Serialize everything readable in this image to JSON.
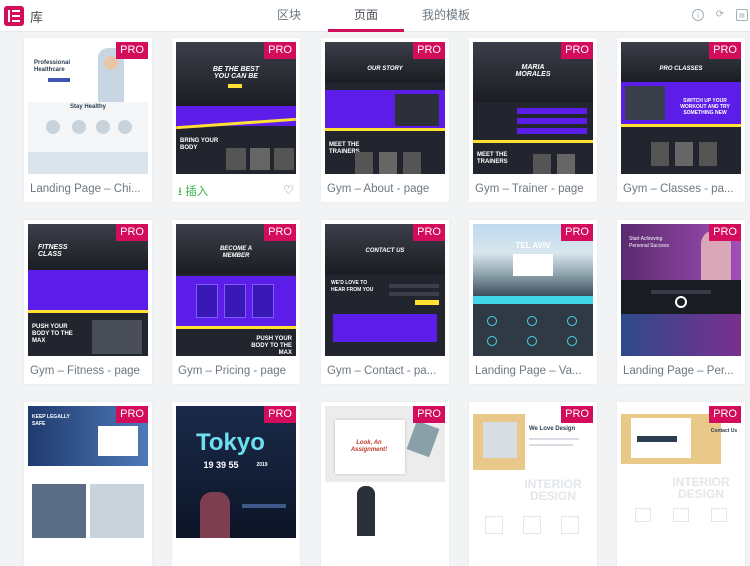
{
  "header": {
    "title": "库",
    "tabs": [
      {
        "label": "区块",
        "active": false
      },
      {
        "label": "页面",
        "active": true
      },
      {
        "label": "我的模板",
        "active": false
      }
    ],
    "icons": [
      "info-icon",
      "sync-icon",
      "save-icon"
    ]
  },
  "colors": {
    "accent": "#d30c5c",
    "insert": "#39b54a",
    "gym_purple": "#5c1de8",
    "gym_yellow": "#ffe033"
  },
  "cards": [
    {
      "caption": "Landing Page – Chi...",
      "badge": "PRO",
      "thumb_text": [
        "Professional Healthcare",
        "Stay Healthy"
      ]
    },
    {
      "caption": "",
      "badge": "PRO",
      "insert_label": "插入",
      "thumb_text": [
        "BE THE BEST YOU CAN BE",
        "BRING YOUR BODY"
      ]
    },
    {
      "caption": "Gym – About - page",
      "badge": "PRO",
      "thumb_text": [
        "OUR STORY",
        "MEET THE TRAINERS"
      ]
    },
    {
      "caption": "Gym – Trainer - page",
      "badge": "PRO",
      "thumb_text": [
        "MARIA MORALES",
        "MEET THE TRAINERS"
      ]
    },
    {
      "caption": "Gym – Classes - pa...",
      "badge": "PRO",
      "thumb_text": [
        "PRO CLASSES",
        "SWITCH UP YOUR WORKOUT AND TRY SOMETHING NEW"
      ]
    },
    {
      "caption": "Gym – Fitness - page",
      "badge": "PRO",
      "thumb_text": [
        "FITNESS CLASS",
        "PUSH YOUR BODY TO THE MAX"
      ]
    },
    {
      "caption": "Gym – Pricing - page",
      "badge": "PRO",
      "thumb_text": [
        "BECOME A MEMBER",
        "PUSH YOUR BODY TO THE MAX"
      ]
    },
    {
      "caption": "Gym – Contact - pa...",
      "badge": "PRO",
      "thumb_text": [
        "CONTACT US",
        "WE'D LOVE TO HEAR FROM YOU"
      ]
    },
    {
      "caption": "Landing Page – Va...",
      "badge": "PRO",
      "thumb_text": [
        "TEL AVIV"
      ]
    },
    {
      "caption": "Landing Page – Per...",
      "badge": "PRO",
      "thumb_text": [
        "Start Achieving Personal Success"
      ]
    },
    {
      "caption": "",
      "badge": "PRO",
      "thumb_text": [
        "KEEP LEGALLY SAFE"
      ]
    },
    {
      "caption": "",
      "badge": "PRO",
      "thumb_text": [
        "Tokyo",
        "19 39 55",
        "2019"
      ]
    },
    {
      "caption": "",
      "badge": "PRO",
      "thumb_text": [
        "Look, An Assignment!"
      ]
    },
    {
      "caption": "",
      "badge": "PRO",
      "thumb_text": [
        "We Love Design",
        "INTERIOR DESIGN"
      ]
    },
    {
      "caption": "",
      "badge": "PRO",
      "thumb_text": [
        "INTERIOR DESIGN",
        "Contact Us"
      ]
    }
  ]
}
